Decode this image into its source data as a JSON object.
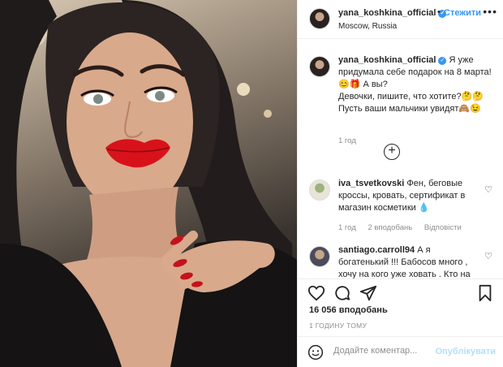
{
  "header": {
    "username": "yana_koshkina_official",
    "separator": "•",
    "follow_label": "Стежити",
    "location": "Moscow, Russia",
    "more_icon": "more-horizontal-icon"
  },
  "caption": {
    "username": "yana_koshkina_official",
    "text_lines": [
      "Я уже",
      "придумала себе подарок на 8 марта!",
      "😊🎁 А вы?",
      "Девочки, пишите, что хотите?🤔🤔",
      "Пусть ваши мальчики увидят🙈😉"
    ],
    "time": "1 год"
  },
  "load_more_icon": "plus-circle-icon",
  "comments": [
    {
      "username": "iva_tsvetkovski",
      "text": "Фен, беговые кроссы, кровать, сертификат в магазин косметики 💧",
      "time": "1 год",
      "likes": "2 вподобань",
      "reply": "Відповісти"
    },
    {
      "username": "santiago.carroll94",
      "text": "А я богатенький !!! Бабосов много , хочу на кого уже ховать . Кто на",
      "time": "",
      "likes": "",
      "reply": ""
    }
  ],
  "actions": {
    "like_icon": "heart-icon",
    "comment_icon": "comment-icon",
    "share_icon": "share-icon",
    "save_icon": "bookmark-icon"
  },
  "likes_count": "16 056 вподобань",
  "posted_time": "1 ГОДИНУ ТОМУ",
  "add_comment": {
    "placeholder": "Додайте коментар...",
    "publish_label": "Опублікувати"
  },
  "colors": {
    "accent": "#3897f0",
    "publish_disabled": "#b2dffc",
    "secondary_text": "#8e8e8e",
    "text": "#262626"
  }
}
